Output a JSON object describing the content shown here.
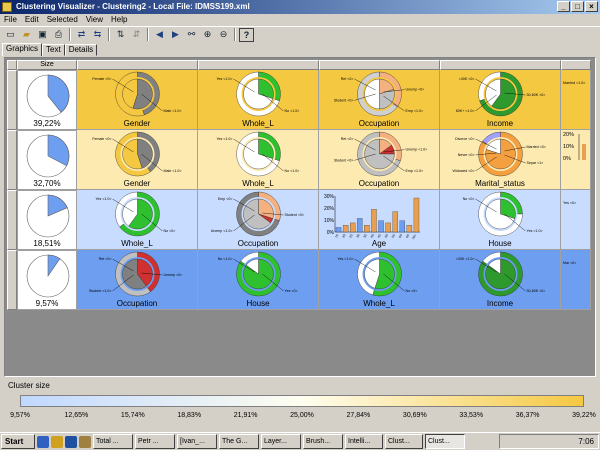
{
  "window": {
    "title": "Clustering Visualizer - Clustering2 - Local File: IDMSS199.xml",
    "controls": [
      "_",
      "□",
      "×"
    ]
  },
  "menu": [
    "File",
    "Edit",
    "Selected",
    "View",
    "Help"
  ],
  "toolbar": [
    "new-icon",
    "open-icon",
    "save-icon",
    "print-icon",
    "swap-rows-icon",
    "swap-cols-icon",
    "sort-icon",
    "sort-alt-icon",
    "left-arrow-icon",
    "right-arrow-icon",
    "binoculars-icon",
    "zoom-in-icon",
    "zoom-out-icon",
    "help-icon"
  ],
  "tabs": [
    "Graphics",
    "Text",
    "Details"
  ],
  "grid": {
    "size_header": "Size",
    "rows": [
      {
        "size_label": "39,22%",
        "size_value": 39.22,
        "bg": "#f5c842",
        "cells": [
          {
            "label": "Gender",
            "kind": "ring",
            "inner": [
              [
                "#808080",
                0.55
              ],
              [
                "#f5c842",
                0.45
              ]
            ],
            "outer": [
              [
                "#808080",
                0.45
              ],
              [
                "#f5c842",
                0.55
              ]
            ],
            "anns": [
              "Female <0>",
              "Male <1.0>"
            ]
          },
          {
            "label": "Whole_L",
            "kind": "ring",
            "inner": [
              [
                "#2ec02e",
                0.3
              ],
              [
                "#ffffff",
                0.7
              ]
            ],
            "outer": [
              [
                "#2ec02e",
                0.3
              ],
              [
                "#ffffff",
                0.7
              ]
            ],
            "anns": [
              "Yes <1.0>",
              "No <1.0>"
            ]
          },
          {
            "label": "Occupation",
            "kind": "ring",
            "inner": [
              [
                "#f5b080",
                0.2
              ],
              [
                "#c0c0c0",
                0.3
              ],
              [
                "#ffffff",
                0.5
              ]
            ],
            "outer": [
              [
                "#f5b080",
                0.35
              ],
              [
                "#d0d0d0",
                0.65
              ]
            ],
            "anns": [
              "Ret <0>",
              "Unemp <0>",
              "Student <0>",
              "Emp <1.0>"
            ]
          },
          {
            "label": "Income",
            "kind": "ring",
            "inner": [
              [
                "#2e9a2e",
                0.6
              ],
              [
                "#ffffff",
                0.4
              ]
            ],
            "outer": [
              [
                "#2e9a2e",
                0.7
              ],
              [
                "#ffffff",
                0.3
              ]
            ],
            "anns": [
              "<30K <0>",
              "30-60K <0>",
              "60K+ <1.0>"
            ]
          },
          {
            "label": "",
            "kind": "blank",
            "anns": [
              "Married <1.0>"
            ]
          }
        ]
      },
      {
        "size_label": "32,70%",
        "size_value": 32.7,
        "bg": "#fdeab0",
        "cells": [
          {
            "label": "Gender",
            "kind": "ring",
            "inner": [
              [
                "#808080",
                0.45
              ],
              [
                "#f5c842",
                0.55
              ]
            ],
            "outer": [
              [
                "#808080",
                0.4
              ],
              [
                "#f5c842",
                0.6
              ]
            ],
            "anns": [
              "Female <0>",
              "Male <1.0>"
            ]
          },
          {
            "label": "Whole_L",
            "kind": "ring",
            "inner": [
              [
                "#2ec02e",
                0.3
              ],
              [
                "#ffffff",
                0.7
              ]
            ],
            "outer": [
              [
                "#2ec02e",
                0.3
              ],
              [
                "#ffffff",
                0.7
              ]
            ],
            "anns": [
              "Yes <1.0>",
              "No <1.0>"
            ]
          },
          {
            "label": "Occupation",
            "kind": "ring",
            "inner": [
              [
                "#f5b080",
                0.15
              ],
              [
                "#d03030",
                0.1
              ],
              [
                "#c0c0c0",
                0.75
              ]
            ],
            "outer": [
              [
                "#f5b080",
                0.3
              ],
              [
                "#c0c0c0",
                0.7
              ]
            ],
            "anns": [
              "Ret <0>",
              "Unemp <1.0>",
              "Student <0>",
              "Emp <1.0>"
            ]
          },
          {
            "label": "Marital_status",
            "kind": "ring",
            "inner": [
              [
                "#f5a040",
                0.8
              ],
              [
                "#ffffff",
                0.2
              ]
            ],
            "outer": [
              [
                "#f5a040",
                0.85
              ],
              [
                "#a0a0ff",
                0.15
              ]
            ],
            "anns": [
              "Divorce <0>",
              "Married <0>",
              "Never <0>",
              "Separ <1>",
              "Widowed <0>"
            ]
          },
          {
            "label": "",
            "kind": "bars-mini",
            "ticks": [
              "20%",
              "10%",
              "0%"
            ]
          }
        ]
      },
      {
        "size_label": "18,51%",
        "size_value": 18.51,
        "bg": "#c8dcff",
        "cells": [
          {
            "label": "Whole_L",
            "kind": "ring",
            "inner": [
              [
                "#2ec02e",
                0.6
              ],
              [
                "#ffffff",
                0.4
              ]
            ],
            "outer": [
              [
                "#2ec02e",
                0.65
              ],
              [
                "#ffffff",
                0.35
              ]
            ],
            "anns": [
              "Yes <1.0>",
              "No <0>"
            ]
          },
          {
            "label": "Occupation",
            "kind": "ring",
            "inner": [
              [
                "#f5b080",
                0.3
              ],
              [
                "#d03030",
                0.05
              ],
              [
                "#c0c0c0",
                0.65
              ]
            ],
            "outer": [
              [
                "#f5b080",
                0.3
              ],
              [
                "#808080",
                0.7
              ]
            ],
            "anns": [
              "Emp <0>",
              "Student <0>",
              "Unemp <1.0>"
            ]
          },
          {
            "label": "Age",
            "kind": "bars",
            "ticks": [
              "30%",
              "20%",
              "10%",
              "0%"
            ],
            "values": [
              4,
              6,
              8,
              12,
              6,
              20,
              10,
              8,
              18,
              10,
              6,
              30
            ],
            "xlabels": [
              "15",
              "20",
              "25",
              "30",
              "35",
              "40",
              "45",
              "50",
              "55",
              "60",
              "65",
              "70+"
            ]
          },
          {
            "label": "House",
            "kind": "ring",
            "inner": [
              [
                "#2ec02e",
                0.3
              ],
              [
                "#ffffff",
                0.7
              ]
            ],
            "outer": [
              [
                "#2ec02e",
                0.25
              ],
              [
                "#ffffff",
                0.75
              ]
            ],
            "anns": [
              "No <0>",
              "Yes <1.0>"
            ]
          },
          {
            "label": "",
            "kind": "blank",
            "anns": [
              "Yes <0>"
            ]
          }
        ]
      },
      {
        "size_label": "9,57%",
        "size_value": 9.57,
        "bg": "#6e9ef0",
        "cells": [
          {
            "label": "Occupation",
            "kind": "ring",
            "inner": [
              [
                "#d03030",
                0.4
              ],
              [
                "#808080",
                0.6
              ]
            ],
            "outer": [
              [
                "#d03030",
                0.4
              ],
              [
                "#c0c0c0",
                0.6
              ]
            ],
            "anns": [
              "Ret <0>",
              "Unemp <0>",
              "Student <1.0>"
            ]
          },
          {
            "label": "House",
            "kind": "ring",
            "inner": [
              [
                "#2ec02e",
                0.85
              ],
              [
                "#ffffff",
                0.15
              ]
            ],
            "outer": [
              [
                "#2ec02e",
                0.85
              ],
              [
                "#ffffff",
                0.15
              ]
            ],
            "anns": [
              "No <1.0>",
              "Yes <0>"
            ]
          },
          {
            "label": "Whole_L",
            "kind": "ring",
            "inner": [
              [
                "#2ec02e",
                0.55
              ],
              [
                "#ffffff",
                0.45
              ]
            ],
            "outer": [
              [
                "#2ec02e",
                0.55
              ],
              [
                "#ffffff",
                0.45
              ]
            ],
            "anns": [
              "Yes <1.0>",
              "No <0>"
            ]
          },
          {
            "label": "Income",
            "kind": "ring",
            "inner": [
              [
                "#2e9a2e",
                0.85
              ],
              [
                "#ffffff",
                0.15
              ]
            ],
            "outer": [
              [
                "#2e9a2e",
                0.85
              ],
              [
                "#ffffff",
                0.15
              ]
            ],
            "anns": [
              "<30K <1.0>",
              "30-60K <0>"
            ]
          },
          {
            "label": "",
            "kind": "blank",
            "anns": [
              "Mar <0>"
            ]
          }
        ]
      }
    ]
  },
  "legend": {
    "title": "Cluster size",
    "ticks": [
      "9,57%",
      "12,65%",
      "15,74%",
      "18,83%",
      "21,91%",
      "25,00%",
      "27,84%",
      "30,69%",
      "33,53%",
      "36,37%",
      "39,22%"
    ]
  },
  "taskbar": {
    "start": "Start",
    "tasks": [
      "Total ...",
      "Petr ...",
      "[Ivan_...",
      "The G...",
      "Layer...",
      "Brush...",
      "Intelli...",
      "Clust...",
      "Clust..."
    ],
    "active_task_index": 8,
    "clock": "7:06"
  }
}
